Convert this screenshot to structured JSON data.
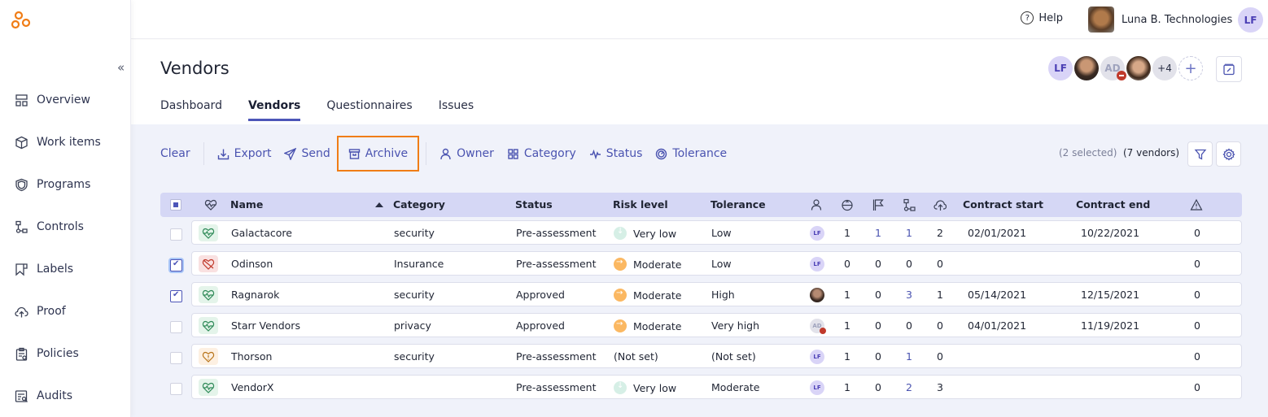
{
  "app": {
    "brand_color": "#f07d16",
    "accent_color": "#4d56b8"
  },
  "sidebar": {
    "collapse_label": "«",
    "items": [
      {
        "label": "Overview",
        "icon": "overview-icon"
      },
      {
        "label": "Work items",
        "icon": "box-icon"
      },
      {
        "label": "Programs",
        "icon": "shield-icon"
      },
      {
        "label": "Controls",
        "icon": "controls-icon"
      },
      {
        "label": "Labels",
        "icon": "label-icon"
      },
      {
        "label": "Proof",
        "icon": "cloud-upload-icon"
      },
      {
        "label": "Policies",
        "icon": "clipboard-icon"
      },
      {
        "label": "Audits",
        "icon": "audit-icon"
      }
    ]
  },
  "topbar": {
    "help_label": "Help",
    "org_name": "Luna B. Technologies",
    "user_initials": "LF"
  },
  "page": {
    "title": "Vendors",
    "tabs": [
      {
        "label": "Dashboard",
        "active": false
      },
      {
        "label": "Vendors",
        "active": true
      },
      {
        "label": "Questionnaires",
        "active": false
      },
      {
        "label": "Issues",
        "active": false
      }
    ],
    "members": [
      {
        "type": "initials",
        "label": "LF"
      },
      {
        "type": "photo",
        "label": ""
      },
      {
        "type": "initials-removed",
        "label": "AD"
      },
      {
        "type": "photo",
        "label": ""
      },
      {
        "type": "more",
        "label": "+4"
      },
      {
        "type": "add",
        "label": "+"
      }
    ]
  },
  "toolbar": {
    "clear": "Clear",
    "export": "Export",
    "send": "Send",
    "archive": "Archive",
    "owner": "Owner",
    "category": "Category",
    "status": "Status",
    "tolerance": "Tolerance",
    "selected_text": "(2 selected)",
    "count_text": "(7 vendors)"
  },
  "table": {
    "columns": {
      "name": "Name",
      "category": "Category",
      "status": "Status",
      "risk": "Risk level",
      "tolerance": "Tolerance",
      "contract_start": "Contract start",
      "contract_end": "Contract end"
    },
    "icon_columns": [
      "owner-icon",
      "assessment-icon",
      "flag-icon",
      "controls-icon",
      "cloud-upload-icon",
      "warning-icon"
    ],
    "rows": [
      {
        "name": "Galactacore",
        "health": "green",
        "checked": false,
        "category": "security",
        "status": "Pre-assessment",
        "risk": "Very low",
        "risk_kind": "verylow",
        "tolerance": "Low",
        "owner": "LF",
        "owner_kind": "lf",
        "c1": "1",
        "c2": "1",
        "c3": "1",
        "c4": "2",
        "start": "02/01/2021",
        "end": "10/22/2021",
        "issues": "0",
        "c2_link": true,
        "c3_link": true
      },
      {
        "name": "Odinson",
        "health": "red",
        "checked": true,
        "category": "Insurance",
        "status": "Pre-assessment",
        "risk": "Moderate",
        "risk_kind": "moderate",
        "tolerance": "Low",
        "owner": "LF",
        "owner_kind": "lf",
        "c1": "0",
        "c2": "0",
        "c3": "0",
        "c4": "0",
        "start": "",
        "end": "",
        "issues": "0",
        "c2_link": false,
        "c3_link": false
      },
      {
        "name": "Ragnarok",
        "health": "green",
        "checked": true,
        "category": "security",
        "status": "Approved",
        "risk": "Moderate",
        "risk_kind": "moderate",
        "tolerance": "High",
        "owner": "",
        "owner_kind": "photo",
        "c1": "1",
        "c2": "0",
        "c3": "3",
        "c4": "1",
        "start": "05/14/2021",
        "end": "12/15/2021",
        "issues": "0",
        "c2_link": false,
        "c3_link": true
      },
      {
        "name": "Starr Vendors",
        "health": "green",
        "checked": false,
        "category": "privacy",
        "status": "Approved",
        "risk": "Moderate",
        "risk_kind": "moderate",
        "tolerance": "Very high",
        "owner": "AD",
        "owner_kind": "ad",
        "c1": "1",
        "c2": "0",
        "c3": "0",
        "c4": "0",
        "start": "04/01/2021",
        "end": "11/19/2021",
        "issues": "0",
        "c2_link": false,
        "c3_link": false
      },
      {
        "name": "Thorson",
        "health": "orange",
        "checked": false,
        "category": "security",
        "status": "Pre-assessment",
        "risk": "(Not set)",
        "risk_kind": "none",
        "tolerance": "(Not set)",
        "owner": "LF",
        "owner_kind": "lf",
        "c1": "1",
        "c2": "0",
        "c3": "1",
        "c4": "0",
        "start": "",
        "end": "",
        "issues": "0",
        "c2_link": false,
        "c3_link": true
      },
      {
        "name": "VendorX",
        "health": "green",
        "checked": false,
        "category": "",
        "status": "Pre-assessment",
        "risk": "Very low",
        "risk_kind": "verylow",
        "tolerance": "Moderate",
        "owner": "LF",
        "owner_kind": "lf",
        "c1": "1",
        "c2": "0",
        "c3": "2",
        "c4": "3",
        "start": "",
        "end": "",
        "issues": "0",
        "c2_link": false,
        "c3_link": true
      }
    ]
  }
}
